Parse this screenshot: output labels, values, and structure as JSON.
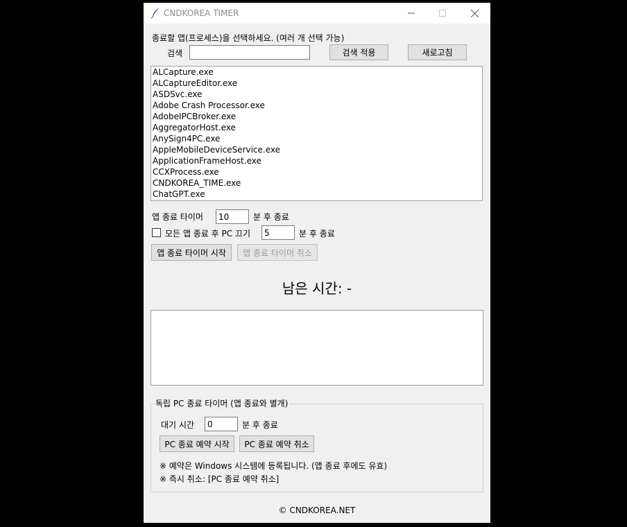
{
  "window": {
    "title": "CNDKOREA TIMER"
  },
  "app_section": {
    "instruction": "종료할 앱(프로세스)을 선택하세요. (여러 개 선택 가능)",
    "search_label": "검색",
    "search_value": "",
    "apply_search_label": "검색 적용",
    "refresh_label": "새로고침",
    "processes": [
      "ALCapture.exe",
      "ALCaptureEditor.exe",
      "ASDSvc.exe",
      "Adobe Crash Processor.exe",
      "AdobeIPCBroker.exe",
      "AggregatorHost.exe",
      "AnySign4PC.exe",
      "AppleMobileDeviceService.exe",
      "ApplicationFrameHost.exe",
      "CCXProcess.exe",
      "CNDKOREA_TIME.exe",
      "ChatGPT.exe"
    ]
  },
  "timer": {
    "app_timer_label": "앱 종료 타이머",
    "app_timer_value": "10",
    "app_timer_suffix": "분 후 종료",
    "pc_off_checkbox_label": "모든 앱 종료 후 PC 끄기",
    "pc_off_checked": false,
    "pc_off_value": "5",
    "pc_off_suffix": "분 후 종료",
    "start_label": "앱 종료 타이머 시작",
    "cancel_label": "앱 종료 타이머 취소",
    "remaining_text": "남은 시간: -"
  },
  "pc_group": {
    "title": "독립 PC 종료 타이머 (앱 종료와 별개)",
    "wait_label": "대기 시간",
    "wait_value": "0",
    "wait_suffix": "분 후 종료",
    "start_label": "PC 종료 예약 시작",
    "cancel_label": "PC 종료 예약 취소",
    "note1": "※ 예약은 Windows 시스템에 등록됩니다. (앱 종료 후에도 유효)",
    "note2": "※ 즉시 취소: [PC 종료 예약 취소]"
  },
  "footer": {
    "copyright": "© CNDKOREA.NET"
  },
  "icons": {
    "app": "feather-icon",
    "minimize": "minimize-icon",
    "maximize": "maximize-icon",
    "close": "close-icon"
  }
}
